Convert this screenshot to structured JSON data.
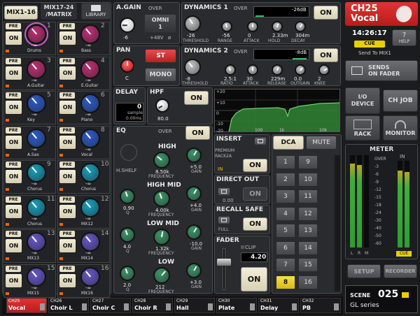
{
  "tabs": {
    "mix1_16": "MIX1-16",
    "mix17_24": "MIX17-24\n/MATRIX",
    "library": "LIBRARY"
  },
  "mixes": [
    {
      "num": "1",
      "name": "Drums",
      "color": "#cc2f7a",
      "on": "ON",
      "pre": "PRE"
    },
    {
      "num": "2",
      "name": "Bass",
      "color": "#cc2f7a",
      "on": "ON",
      "pre": "PRE"
    },
    {
      "num": "3",
      "name": "A.Guitar",
      "color": "#cc2f7a",
      "on": "ON",
      "pre": "PRE"
    },
    {
      "num": "4",
      "name": "E.Guitar",
      "color": "#cc2f7a",
      "on": "ON",
      "pre": "PRE"
    },
    {
      "num": "5",
      "name": "Key",
      "color": "#2e5fd8",
      "on": "ON",
      "pre": "PRE"
    },
    {
      "num": "6",
      "name": "Piano",
      "color": "#2e5fd8",
      "on": "ON",
      "pre": "PRE"
    },
    {
      "num": "7",
      "name": "A.Sax",
      "color": "#2e5fd8",
      "on": "ON",
      "pre": "PRE"
    },
    {
      "num": "8",
      "name": "Vocal",
      "color": "#2e5fd8",
      "on": "ON",
      "pre": "PRE"
    },
    {
      "num": "9",
      "name": "Chorus",
      "color": "#18a9c8",
      "on": "ON",
      "pre": "PRE"
    },
    {
      "num": "10",
      "name": "Chorus",
      "color": "#18a9c8",
      "on": "ON",
      "pre": "PRE"
    },
    {
      "num": "11",
      "name": "Chorus",
      "color": "#18a9c8",
      "on": "ON",
      "pre": "PRE"
    },
    {
      "num": "12",
      "name": "MX12",
      "color": "#18a9c8",
      "on": "ON",
      "pre": "PRE"
    },
    {
      "num": "13",
      "name": "MX13",
      "color": "#6d5ad6",
      "on": "ON",
      "pre": "PRE"
    },
    {
      "num": "14",
      "name": "MX14",
      "color": "#6d5ad6",
      "on": "ON",
      "pre": "PRE"
    },
    {
      "num": "15",
      "name": "MX15",
      "color": "#6d5ad6",
      "on": "ON",
      "pre": "PRE"
    },
    {
      "num": "16",
      "name": "MX16",
      "color": "#6d5ad6",
      "on": "ON",
      "pre": "PRE"
    }
  ],
  "infinity": "-∞",
  "again": {
    "title": "A.GAIN",
    "over": "OVER",
    "value": "-6",
    "omni": "OMNI\n1",
    "phantom": "+48V",
    "phase": "ø"
  },
  "pan": {
    "title": "PAN",
    "st": "ST",
    "mono": "MONO",
    "value": "C"
  },
  "delay": {
    "title": "DELAY",
    "value": "0",
    "unit": "sample",
    "ms": "0.00ms"
  },
  "hpf": {
    "title": "HPF",
    "value": "80.0",
    "on": "ON"
  },
  "dyn1": {
    "title": "DYNAMICS 1",
    "over": "OVER",
    "level": "-26dB",
    "on": "ON",
    "knobs": [
      {
        "label": "THRESHOLD",
        "value": "-26"
      },
      {
        "label": "RANGE",
        "value": "-56"
      },
      {
        "label": "ATTACK",
        "value": "0"
      },
      {
        "label": "HOLD",
        "value": "2.33m"
      },
      {
        "label": "DECAY",
        "value": "304m"
      }
    ]
  },
  "dyn2": {
    "title": "DYNAMICS 2",
    "over": "OVER",
    "level": "-8dB",
    "on": "ON",
    "knobs": [
      {
        "label": "THRESHOLD",
        "value": "-8"
      },
      {
        "label": "RATIO",
        "value": "2.5:1"
      },
      {
        "label": "ATTACK",
        "value": "30"
      },
      {
        "label": "RELEASE",
        "value": "229m"
      },
      {
        "label": "OUTGAIN",
        "value": "0.0"
      },
      {
        "label": "KNEE",
        "value": "2"
      }
    ]
  },
  "graph": {
    "y": [
      "+20",
      "+10",
      "0",
      "-10",
      "-20"
    ],
    "x": [
      "100",
      "1k",
      "10k"
    ]
  },
  "eq": {
    "title": "EQ",
    "over": "OVER",
    "on": "ON",
    "hshelf": "H.SHELF",
    "bands": [
      {
        "name": "HIGH",
        "q": "",
        "freq": "8.50k",
        "gain": "+5.0"
      },
      {
        "name": "HIGH MID",
        "q": "0.90",
        "freq": "4.00k",
        "gain": "+4.0"
      },
      {
        "name": "LOW MID",
        "q": "4.0",
        "freq": "1.32k",
        "gain": "-10.0"
      },
      {
        "name": "LOW",
        "q": "2.0",
        "freq": "212",
        "gain": "+3.0"
      }
    ],
    "qlabel": "Q",
    "freqlabel": "FREQUENCY",
    "gainlabel": "GAIN"
  },
  "insert": {
    "title": "INSERT",
    "device": "PREMIUM\nRACK2A",
    "in": "IN",
    "on": "ON"
  },
  "direct": {
    "title": "DIRECT OUT",
    "value": "0.00",
    "on": "ON"
  },
  "recall": {
    "title": "RECALL SAFE",
    "full": "FULL",
    "on": "ON"
  },
  "fader": {
    "title": "FADER",
    "clip": "CLIP",
    "value": "4.20",
    "on": "ON"
  },
  "dca": {
    "tab_dca": "DCA",
    "tab_mute": "MUTE",
    "buttons": [
      "1",
      "9",
      "2",
      "10",
      "3",
      "11",
      "4",
      "12",
      "5",
      "13",
      "6",
      "14",
      "7",
      "15",
      "8",
      "16"
    ]
  },
  "channel": {
    "name": "CH25",
    "label": "Vocal",
    "time": "14:26:17",
    "cue": "CUE",
    "help": "HELP",
    "send": "Send To MIX1"
  },
  "right": {
    "sends": "SENDS\nON FADER",
    "io": "I/O\nDEVICE",
    "chjob": "CH JOB",
    "rack": "RACK",
    "monitor": "MONITOR",
    "meter": "METER",
    "setup": "SETUP",
    "recorder": "RECORDER",
    "scene": "SCENE",
    "scene_num": "025",
    "scene_name": "GL series",
    "meter_labels": [
      "OVER",
      "-3",
      "-6",
      "-9",
      "-12",
      "-15",
      "-18",
      "-24",
      "-30",
      "-40",
      "-50",
      "-60"
    ],
    "lrm": [
      "L",
      "R",
      "M"
    ],
    "in": "IN",
    "cue": "CUE"
  },
  "bottom": [
    {
      "ch": "CH25",
      "name": "Vocal",
      "active": true
    },
    {
      "ch": "CH26",
      "name": "Choir L"
    },
    {
      "ch": "CH27",
      "name": "Choir C"
    },
    {
      "ch": "CH28",
      "name": "Choir R"
    },
    {
      "ch": "CH29",
      "name": "Hall"
    },
    {
      "ch": "CH30",
      "name": "Plate"
    },
    {
      "ch": "CH31",
      "name": "Delay"
    },
    {
      "ch": "CH32",
      "name": "PB"
    }
  ],
  "colors": {
    "accent": "#d92424",
    "knob_pink": "#cc2f7a",
    "knob_blue": "#2e5fd8",
    "knob_cyan": "#18a9c8",
    "knob_purple": "#6d5ad6",
    "eq_green": "#3a9d6a",
    "btn_on": "#f3eed8"
  }
}
